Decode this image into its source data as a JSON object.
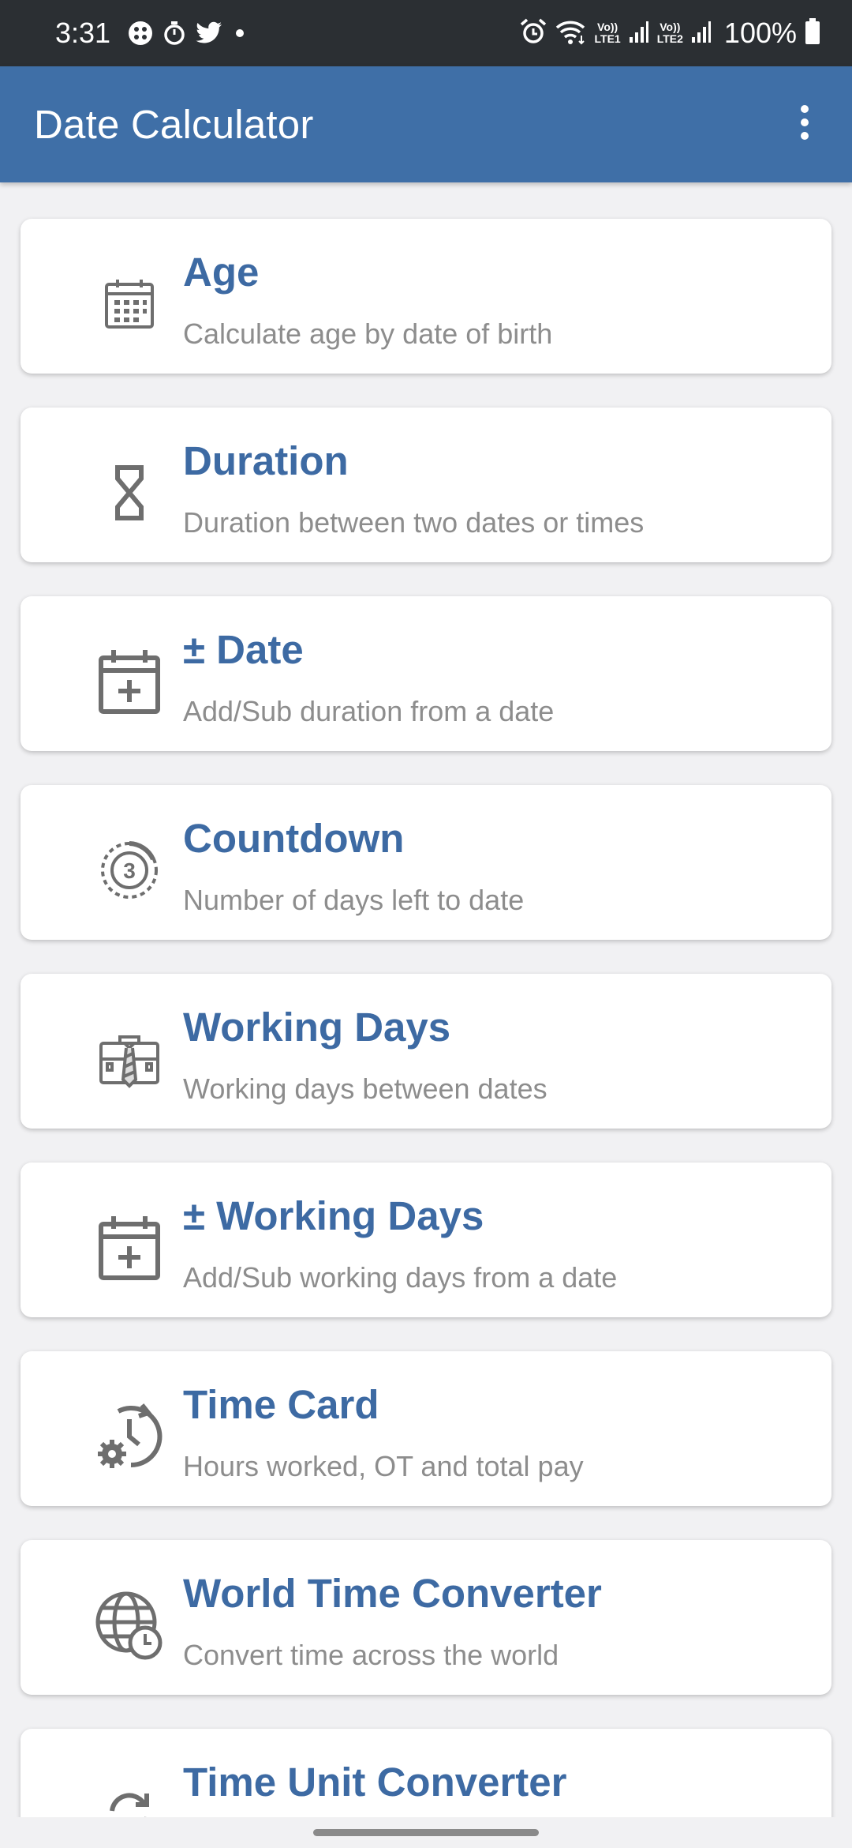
{
  "status_bar": {
    "time": "3:31",
    "left_icons": [
      "dots-icon",
      "stopwatch-icon",
      "twitter-icon",
      "dot-icon"
    ],
    "sim1_label_top": "Vo))",
    "sim1_label_bottom": "LTE1",
    "sim2_label_top": "Vo))",
    "sim2_label_bottom": "LTE2",
    "battery": "100%"
  },
  "app_bar": {
    "title": "Date Calculator",
    "menu_icon": "more-vert-icon"
  },
  "items": [
    {
      "title": "Age",
      "subtitle": "Calculate age by date of birth",
      "icon": "calendar-grid-icon"
    },
    {
      "title": "Duration",
      "subtitle": "Duration between two dates or times",
      "icon": "hourglass-icon"
    },
    {
      "title": "± Date",
      "subtitle": "Add/Sub duration from a date",
      "icon": "calendar-plus-icon"
    },
    {
      "title": "Countdown",
      "subtitle": "Number of days left to date",
      "icon": "countdown-icon"
    },
    {
      "title": "Working Days",
      "subtitle": "Working days between dates",
      "icon": "briefcase-icon"
    },
    {
      "title": "± Working Days",
      "subtitle": "Add/Sub working days from a date",
      "icon": "calendar-plus-icon"
    },
    {
      "title": "Time Card",
      "subtitle": "Hours worked, OT and total pay",
      "icon": "clock-gear-icon"
    },
    {
      "title": "World Time Converter",
      "subtitle": "Convert time across the world",
      "icon": "globe-clock-icon"
    },
    {
      "title": "Time Unit Converter",
      "subtitle": "",
      "icon": "sync-icon"
    }
  ],
  "colors": {
    "app_bar": "#3f6fa7",
    "status_bar": "#2b2f33",
    "title_text": "#3d6aa3",
    "subtitle_text": "#8d8d8d",
    "icon_gray": "#6e6e6e"
  }
}
